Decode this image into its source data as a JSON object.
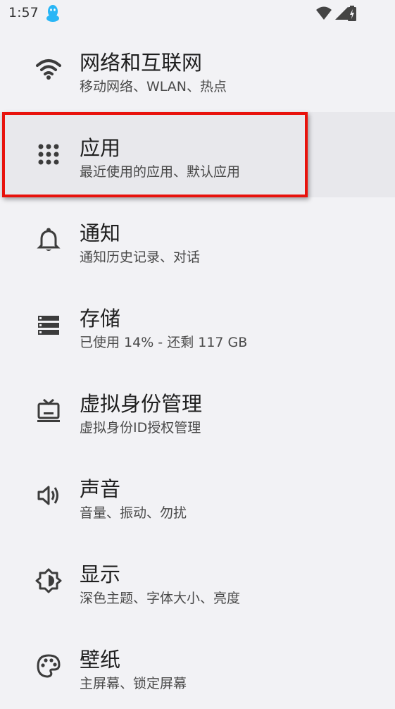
{
  "status_bar": {
    "time": "1:57",
    "icons": [
      "qq-icon",
      "wifi-icon",
      "signal-icon",
      "battery-charging-icon"
    ]
  },
  "settings": {
    "items": [
      {
        "title": "网络和互联网",
        "subtitle": "移动网络、WLAN、热点",
        "icon": "wifi-icon"
      },
      {
        "title": "应用",
        "subtitle": "最近使用的应用、默认应用",
        "icon": "apps-grid-icon",
        "highlighted": true
      },
      {
        "title": "通知",
        "subtitle": "通知历史记录、对话",
        "icon": "bell-icon"
      },
      {
        "title": "存储",
        "subtitle": "已使用 14% - 还剩 117 GB",
        "icon": "storage-icon"
      },
      {
        "title": "虚拟身份管理",
        "subtitle": "虚拟身份ID授权管理",
        "icon": "tv-icon"
      },
      {
        "title": "声音",
        "subtitle": "音量、振动、勿扰",
        "icon": "volume-icon"
      },
      {
        "title": "显示",
        "subtitle": "深色主题、字体大小、亮度",
        "icon": "brightness-icon"
      },
      {
        "title": "壁纸",
        "subtitle": "主屏幕、锁定屏幕",
        "icon": "palette-icon"
      }
    ]
  },
  "colors": {
    "background": "#f2f2f5",
    "highlight": "#e8e8ec",
    "annotation_border": "#e8120c",
    "icon": "#3c3c3c",
    "qq_accent": "#29b6f6"
  }
}
